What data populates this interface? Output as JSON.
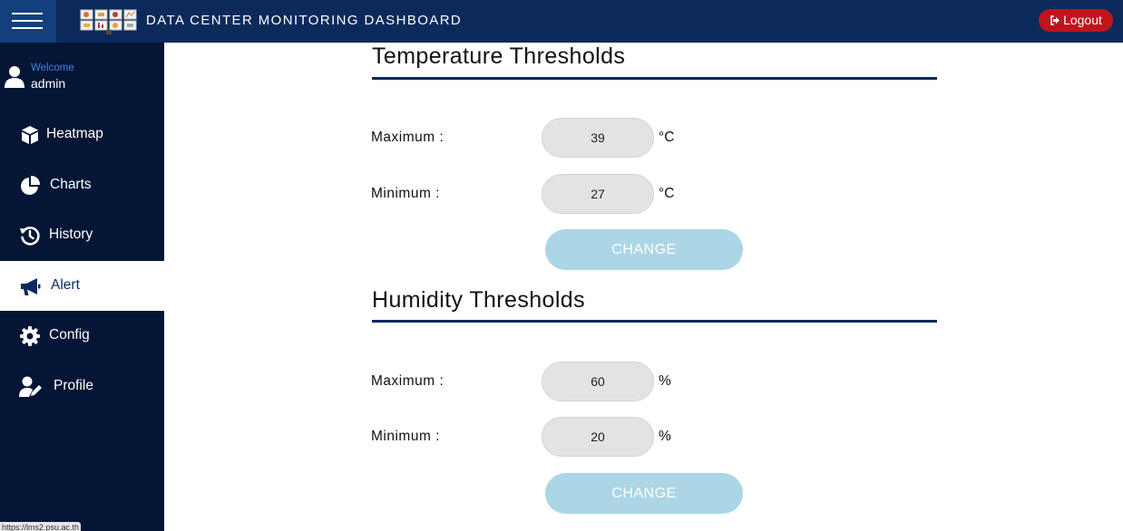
{
  "header": {
    "title": "DATA CENTER MONITORING DASHBOARD",
    "logout_label": "Logout"
  },
  "user": {
    "welcome": "Welcome",
    "name": "admin"
  },
  "sidebar": {
    "items": [
      {
        "label": "Heatmap",
        "icon": "cube-icon"
      },
      {
        "label": "Charts",
        "icon": "pie-chart-icon"
      },
      {
        "label": "History",
        "icon": "history-icon"
      },
      {
        "label": "Alert",
        "icon": "megaphone-icon",
        "active": true
      },
      {
        "label": "Config",
        "icon": "gear-icon"
      },
      {
        "label": "Profile",
        "icon": "user-edit-icon"
      }
    ]
  },
  "temperature": {
    "title": "Temperature Thresholds",
    "max_label": "Maximum :",
    "max_value": "39",
    "min_label": "Minimum :",
    "min_value": "27",
    "unit": "°C",
    "button_label": "CHANGE"
  },
  "humidity": {
    "title": "Humidity Thresholds",
    "max_label": "Maximum :",
    "max_value": "60",
    "min_label": "Minimum :",
    "min_value": "20",
    "unit": "%",
    "button_label": "CHANGE"
  },
  "status_bar": {
    "url": "https://lms2.psu.ac.th"
  },
  "colors": {
    "header_bg": "#0b2a5b",
    "sidebar_bg": "#041535",
    "logout_bg": "#c0141d",
    "button_bg": "#acd6e6",
    "rule": "#0b2a5b"
  }
}
